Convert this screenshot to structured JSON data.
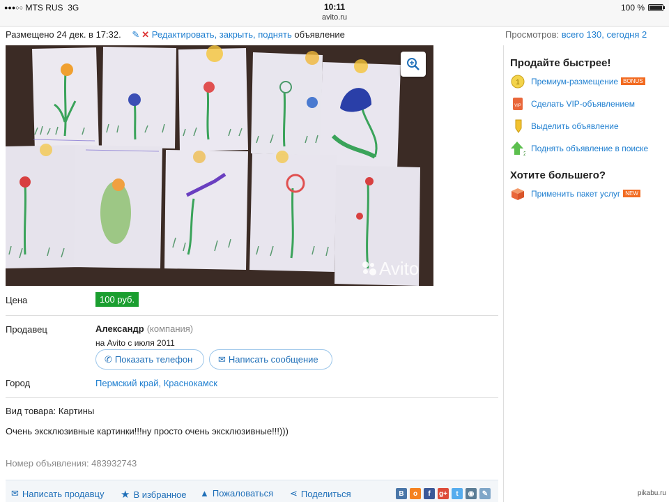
{
  "status_bar": {
    "carrier": "MTS RUS",
    "network": "3G",
    "time": "10:11",
    "url": "avito.ru",
    "battery_text": "100 %",
    "battery_level": 1.0
  },
  "ad": {
    "posted": "Размещено 24 дек. в 17:32.",
    "edit_links": "Редактировать, закрыть, поднять",
    "edit_suffix": "объявление",
    "views_label": "Просмотров:",
    "views_value": "всего 130, сегодня 2",
    "watermark": "Avito",
    "price_label": "Цена",
    "price": "100 руб.",
    "seller_label": "Продавец",
    "seller_name": "Александр",
    "seller_type": "(компания)",
    "seller_since": "на Avito с июля 2011",
    "show_phone": "Показать телефон",
    "write_message": "Написать сообщение",
    "city_label": "Город",
    "city": "Пермский край, Краснокамск",
    "goods_type": "Вид товара: Картины",
    "description": "Очень эксклюзивные картинки!!!ну просто очень эксклюзивные!!!)))",
    "ad_number": "Номер объявления: 483932743"
  },
  "bottom_bar": {
    "write_seller": "Написать продавцу",
    "favorites": "В избранное",
    "complain": "Пожаловаться",
    "share": "Поделиться",
    "social": [
      {
        "name": "vk-icon",
        "glyph": "B",
        "color": "#4a76a8"
      },
      {
        "name": "odnoklassniki-icon",
        "glyph": "o",
        "color": "#f58220"
      },
      {
        "name": "facebook-icon",
        "glyph": "f",
        "color": "#3b5998"
      },
      {
        "name": "google-plus-icon",
        "glyph": "g+",
        "color": "#dd4b39"
      },
      {
        "name": "twitter-icon",
        "glyph": "t",
        "color": "#55acee"
      },
      {
        "name": "livejournal-icon",
        "glyph": "◉",
        "color": "#5b7d96"
      },
      {
        "name": "attach-icon",
        "glyph": "✎",
        "color": "#7fa6c8"
      }
    ]
  },
  "sidebar": {
    "sell_faster": "Продайте быстрее!",
    "services": [
      {
        "label": "Премиум-размещение",
        "tag": "BONUS",
        "icon": "premium-coin-icon"
      },
      {
        "label": "Сделать VIP-объявлением",
        "tag": "",
        "icon": "vip-icon"
      },
      {
        "label": "Выделить объявление",
        "tag": "",
        "icon": "highlighter-icon"
      },
      {
        "label": "Поднять объявление в поиске",
        "tag": "",
        "icon": "raise-arrow-icon"
      }
    ],
    "want_more": "Хотите большего?",
    "package": {
      "label": "Применить пакет услуг",
      "tag": "NEW",
      "icon": "package-box-icon"
    }
  },
  "credit": "pikabu.ru",
  "colors": {
    "link": "#1f7fd0",
    "price_badge": "#1a9e2f",
    "tag_orange": "#f26b21"
  }
}
